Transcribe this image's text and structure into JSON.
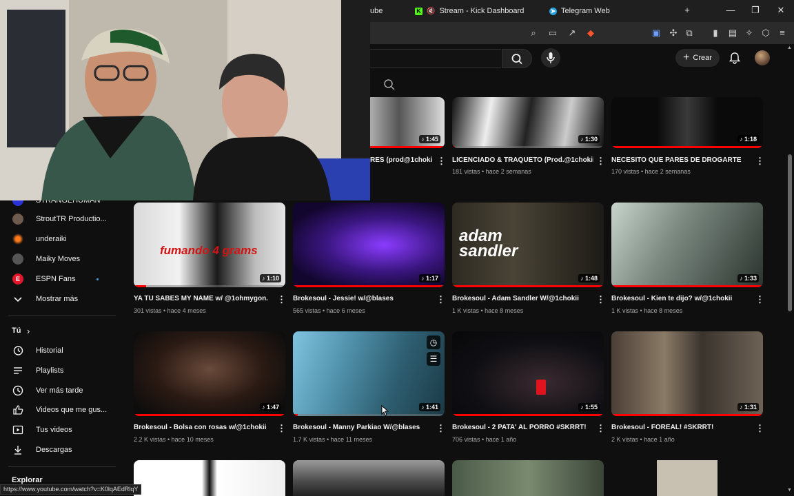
{
  "browser": {
    "tabs": [
      {
        "label": "ube"
      },
      {
        "label": "Stream - Kick Dashboard",
        "icon": "kick-icon"
      },
      {
        "label": "Telegram Web",
        "icon": "telegram-icon"
      }
    ],
    "new_tab": "+",
    "window": {
      "minimize": "—",
      "maximize": "❐",
      "close": "✕"
    }
  },
  "header": {
    "create_label": "Crear",
    "icons": [
      "search-icon",
      "mic-icon",
      "bell-icon",
      "avatar"
    ]
  },
  "sidebar": {
    "subscriptions": [
      {
        "label": "STRANGEHUMAN"
      },
      {
        "label": "StroutTR Productio..."
      },
      {
        "label": "underaiki"
      },
      {
        "label": "Maiky Moves"
      },
      {
        "label": "ESPN Fans"
      }
    ],
    "show_more": "Mostrar más",
    "you_section": "Tú",
    "you_chevron": "›",
    "you_items": [
      {
        "label": "Historial",
        "icon": "history-icon"
      },
      {
        "label": "Playlists",
        "icon": "playlist-icon"
      },
      {
        "label": "Ver más tarde",
        "icon": "watch-later-icon"
      },
      {
        "label": "Videos que me gus...",
        "icon": "like-icon"
      },
      {
        "label": "Tus videos",
        "icon": "your-videos-icon"
      },
      {
        "label": "Descargas",
        "icon": "download-icon"
      }
    ],
    "explore": "Explorar"
  },
  "videos": {
    "row0": [
      {
        "title": "RES (prod@1chokii",
        "meta": "",
        "duration": "1:45"
      },
      {
        "title": "LICENCIADO & TRAQUETO (Prod.@1chokii )",
        "meta": "181 vistas • hace 2 semanas",
        "duration": "1:30"
      },
      {
        "title": "NECESITO QUE PARES DE DROGARTE",
        "meta": "170 vistas • hace 2 semanas",
        "duration": "1:18"
      }
    ],
    "row1": [
      {
        "title": "YA TU SABES MY NAME w/ @1ohmygon.",
        "meta": "301 vistas • hace 4 meses",
        "duration": "1:10",
        "overlay": "fumando 4 grams"
      },
      {
        "title": "Brokesoul - Jessie! w/@blases",
        "meta": "565 vistas • hace 6 meses",
        "duration": "1:17"
      },
      {
        "title": "Brokesoul - Adam Sandler W/@1chokii",
        "meta": "1 K vistas • hace 8 meses",
        "duration": "1:48",
        "overlay": "adam sandler"
      },
      {
        "title": "Brokesoul - Kien te dijo? w/@1chokii",
        "meta": "1 K vistas • hace 8 meses",
        "duration": "1:33"
      }
    ],
    "row2": [
      {
        "title": "Brokesoul - Bolsa con rosas w/@1chokii",
        "meta": "2.2 K vistas • hace 10 meses",
        "duration": "1:47"
      },
      {
        "title": "Brokesoul - Manny Parkiao W/@blases",
        "meta": "1.7 K vistas • hace 11 meses",
        "duration": "1:41"
      },
      {
        "title": "Brokesoul - 2 PATA' AL PORRO #SKRRT!",
        "meta": "706 vistas • hace 1 año",
        "duration": "1:55"
      },
      {
        "title": "Brokesoul - FOREAL! #SKRRT!",
        "meta": "2 K vistas • hace 1 año",
        "duration": "1:31"
      }
    ],
    "kebab": "⋮"
  },
  "status_url": "https://www.youtube.com/watch?v=K0lqAEdRlqY",
  "colors": {
    "accent": "#ff0000",
    "background": "#0f0f0f",
    "link": "#3ea6ff"
  }
}
